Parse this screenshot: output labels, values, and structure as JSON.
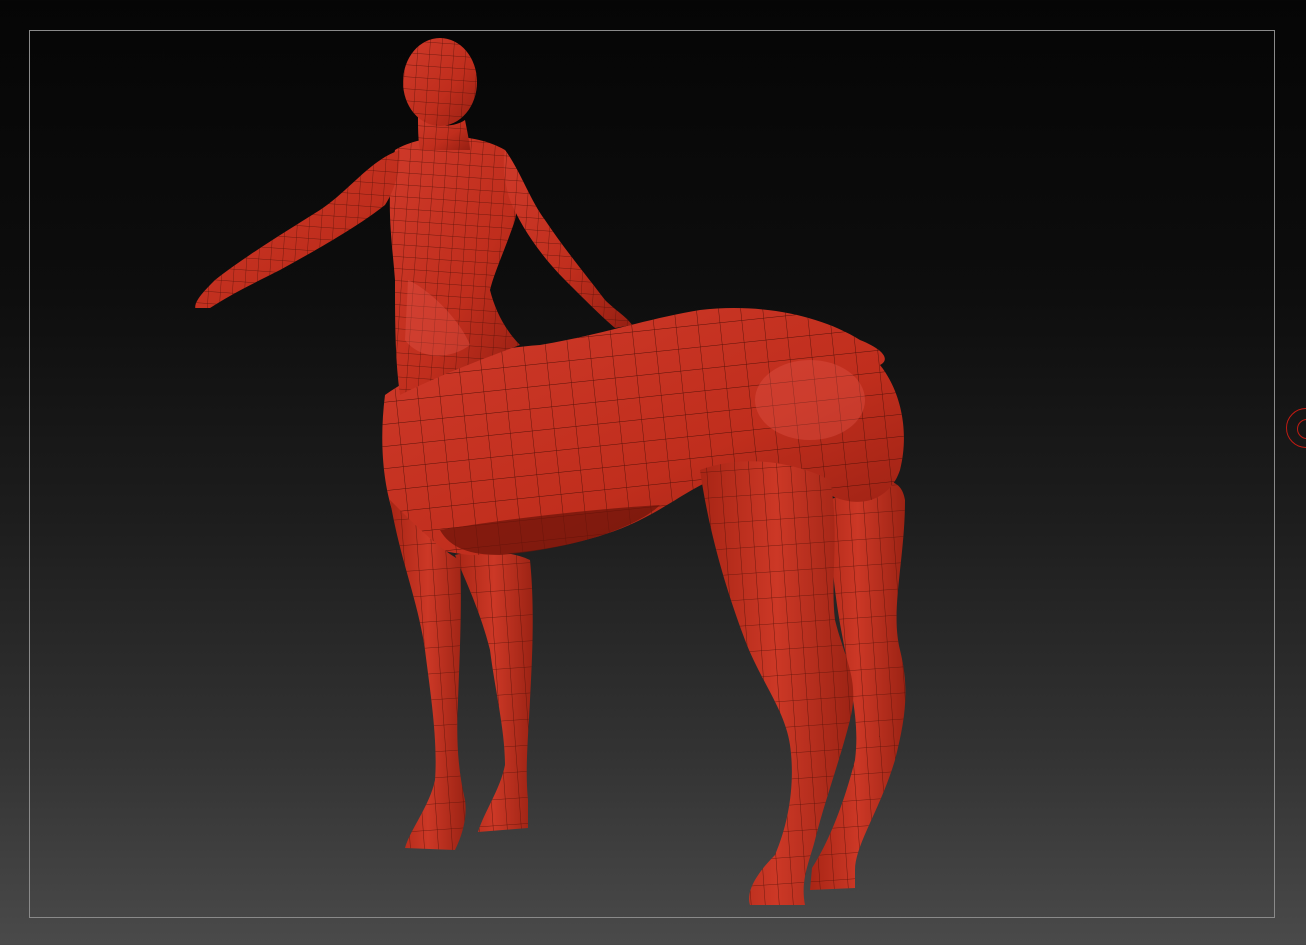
{
  "viewport": {
    "background_top": "#050505",
    "background_bottom": "#4a4a4a",
    "frame_color": "#8a8a8a"
  },
  "model": {
    "subject": "centaur-base-mesh",
    "material_color": "#c4301f",
    "material_shadow": "#8f1f12",
    "material_highlight": "#d9473a",
    "wireframe_color": "#5a1209"
  },
  "gizmo": {
    "icon": "rotation-gizmo-icon",
    "color": "#c21b12"
  }
}
